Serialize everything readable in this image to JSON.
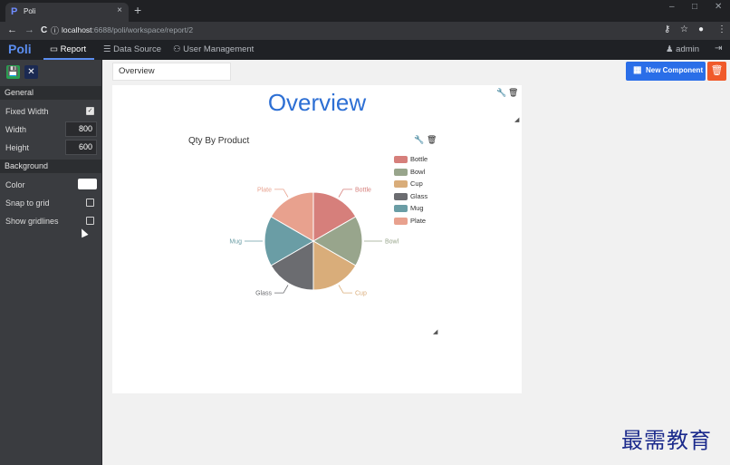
{
  "browser": {
    "tab_favicon": "P",
    "tab_title": "Poli",
    "tab_close": "×",
    "new_tab": "+",
    "win_min": "–",
    "win_max": "□",
    "win_close": "✕",
    "nav_back": "←",
    "nav_forward": "→",
    "nav_reload": "C",
    "info_icon": "ⓘ",
    "url_host": "localhost",
    "url_rest": ":6688/poli/workspace/report/2",
    "key_icon": "⚷",
    "star_icon": "☆",
    "account_icon": "●",
    "more_icon": "⋮"
  },
  "app": {
    "logo": "Poli",
    "menu": [
      {
        "icon": "▭",
        "label": "Report"
      },
      {
        "icon": "☰",
        "label": "Data Source"
      },
      {
        "icon": "⚇",
        "label": "User Management"
      }
    ],
    "admin_icon": "♟",
    "admin": "admin",
    "logout_icon": "⇥"
  },
  "sidebar": {
    "save_icon": "💾",
    "close_icon": "✕",
    "general": "General",
    "fixed_width": "Fixed Width",
    "fixed_width_checked": "✓",
    "width_label": "Width",
    "width_value": "800",
    "height_label": "Height",
    "height_value": "600",
    "background": "Background",
    "color_label": "Color",
    "color_value": "#ffffff",
    "snap_to_grid": "Snap to grid",
    "show_gridlines": "Show gridlines"
  },
  "main": {
    "report_name": "Overview",
    "new_component": "New Component",
    "new_component_icon": "▦",
    "trash_icon": "🗑",
    "report_title": "Overview",
    "wrench_icon": "🔧",
    "delete_icon": "🗑",
    "resize_icon": "◢",
    "chart_title": "Qty By Product"
  },
  "colors": {
    "Bottle": "#d67f7b",
    "Bowl": "#98a58c",
    "Cup": "#d9ad7a",
    "Glass": "#6b6c70",
    "Mug": "#6a9da5",
    "Plate": "#e8a18e"
  },
  "chart_data": {
    "type": "pie",
    "title": "Qty By Product",
    "categories": [
      "Bottle",
      "Bowl",
      "Cup",
      "Glass",
      "Mug",
      "Plate"
    ],
    "values": [
      1,
      1,
      1,
      1,
      1,
      1
    ],
    "legend": "right"
  },
  "watermark": "最需教育"
}
